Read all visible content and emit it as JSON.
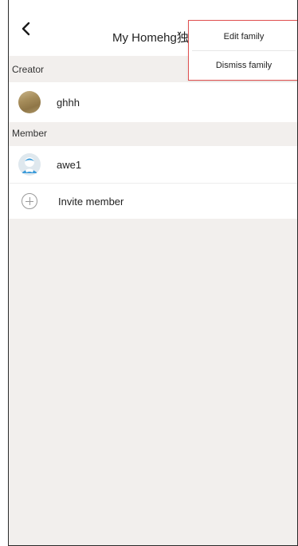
{
  "header": {
    "title": "My Homehg独"
  },
  "popup_menu": {
    "items": [
      "Edit family",
      "Dismiss family"
    ]
  },
  "sections": {
    "creator_label": "Creator",
    "member_label": "Member"
  },
  "creator": {
    "name": "ghhh"
  },
  "members": [
    {
      "name": "awe1"
    }
  ],
  "invite": {
    "label": "Invite member"
  },
  "colors": {
    "popup_border": "#e05050",
    "background": "#f2efed",
    "row_background": "#ffffff"
  },
  "icons": {
    "back": "chevron-left-icon",
    "creator_avatar": "avatar-image",
    "member_avatar": "person-icon",
    "invite": "plus-circle-icon"
  }
}
